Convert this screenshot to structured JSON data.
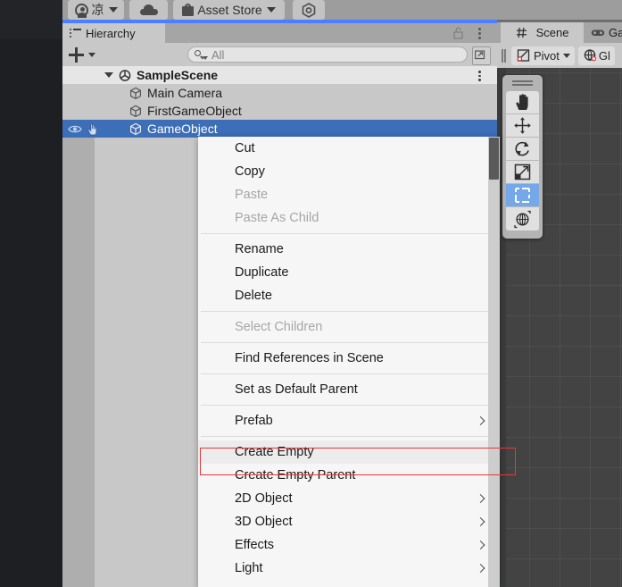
{
  "app": {
    "name": "Unity Editor",
    "accent_blue": "#4c7eff",
    "selection_blue": "#3d6eb8",
    "highlight_red": "#e03a3a",
    "panel_gray": "#c8c8c8",
    "scene_bg": "#434343"
  },
  "top_toolbar": {
    "account_label": "凉",
    "account_icon": "user-circle-icon",
    "cloud_icon": "cloud-icon",
    "asset_store_label": "Asset Store",
    "asset_store_icon": "shopping-bag-icon",
    "extra_icon": "hexagon-unity-icon"
  },
  "hierarchy": {
    "tab_label": "Hierarchy",
    "tab_icon": "hierarchy-list-icon",
    "lock_icon": "lock-open-icon",
    "menu_icon": "kebab-menu-icon",
    "add_label": "+",
    "add_icon": "plus-icon",
    "add_caret_icon": "chevron-down-icon",
    "search_placeholder": "All",
    "search_value": "",
    "search_icon": "search-icon",
    "expand_icon": "expand-window-icon",
    "scene_kebab_icon": "kebab-menu-icon",
    "items": [
      {
        "label": "SampleScene",
        "icon": "unity-scene-icon",
        "depth": 0,
        "bold": true,
        "expanded": true,
        "selected": false
      },
      {
        "label": "Main Camera",
        "icon": "gameobject-cube-icon",
        "depth": 1,
        "bold": false,
        "selected": false
      },
      {
        "label": "FirstGameObject",
        "icon": "gameobject-cube-icon",
        "depth": 1,
        "bold": false,
        "selected": false
      },
      {
        "label": "GameObject",
        "icon": "gameobject-cube-icon",
        "depth": 1,
        "bold": false,
        "selected": true
      }
    ],
    "gutter_icons": [
      "eye-icon",
      "pointer-hand-icon"
    ]
  },
  "scene_window": {
    "scene_tab_label": "Scene",
    "scene_tab_icon": "grid-hash-icon",
    "game_tab_label": "Ga",
    "game_tab_icon": "gamepad-icon",
    "pivot_label": "Pivot",
    "pivot_icon": "pivot-icon",
    "pivot_caret_icon": "chevron-down-icon",
    "global_label": "Gl",
    "global_icon": "globe-icon",
    "grip_icon": "drag-grip-icon"
  },
  "tool_palette": {
    "grip_icon": "drag-handle-icon",
    "tools": [
      {
        "name": "hand-tool",
        "icon": "hand-icon",
        "selected": false
      },
      {
        "name": "move-tool",
        "icon": "move-arrows-icon",
        "selected": false
      },
      {
        "name": "rotate-tool",
        "icon": "rotate-icon",
        "selected": false
      },
      {
        "name": "scale-tool",
        "icon": "scale-icon",
        "selected": false
      },
      {
        "name": "rect-tool",
        "icon": "rect-transform-icon",
        "selected": true
      },
      {
        "name": "transform-tool",
        "icon": "transform-combined-icon",
        "selected": false
      }
    ]
  },
  "context_menu": {
    "groups": [
      {
        "items": [
          {
            "label": "Cut",
            "disabled": false,
            "submenu": false,
            "highlighted": false
          },
          {
            "label": "Copy",
            "disabled": false,
            "submenu": false,
            "highlighted": false
          },
          {
            "label": "Paste",
            "disabled": true,
            "submenu": false,
            "highlighted": false
          },
          {
            "label": "Paste As Child",
            "disabled": true,
            "submenu": false,
            "highlighted": false
          }
        ]
      },
      {
        "items": [
          {
            "label": "Rename",
            "disabled": false,
            "submenu": false,
            "highlighted": false
          },
          {
            "label": "Duplicate",
            "disabled": false,
            "submenu": false,
            "highlighted": false
          },
          {
            "label": "Delete",
            "disabled": false,
            "submenu": false,
            "highlighted": false
          }
        ]
      },
      {
        "items": [
          {
            "label": "Select Children",
            "disabled": true,
            "submenu": false,
            "highlighted": false
          }
        ]
      },
      {
        "items": [
          {
            "label": "Find References in Scene",
            "disabled": false,
            "submenu": false,
            "highlighted": false
          }
        ]
      },
      {
        "items": [
          {
            "label": "Set as Default Parent",
            "disabled": false,
            "submenu": false,
            "highlighted": false
          }
        ]
      },
      {
        "items": [
          {
            "label": "Prefab",
            "disabled": false,
            "submenu": true,
            "highlighted": false
          }
        ]
      },
      {
        "items": [
          {
            "label": "Create Empty",
            "disabled": false,
            "submenu": false,
            "highlighted": true
          },
          {
            "label": "Create Empty Parent",
            "disabled": false,
            "submenu": false,
            "highlighted": false
          },
          {
            "label": "2D Object",
            "disabled": false,
            "submenu": true,
            "highlighted": false
          },
          {
            "label": "3D Object",
            "disabled": false,
            "submenu": true,
            "highlighted": false
          },
          {
            "label": "Effects",
            "disabled": false,
            "submenu": true,
            "highlighted": false
          },
          {
            "label": "Light",
            "disabled": false,
            "submenu": true,
            "highlighted": false
          }
        ]
      }
    ],
    "scrollbar_icon": "vertical-scrollbar"
  }
}
